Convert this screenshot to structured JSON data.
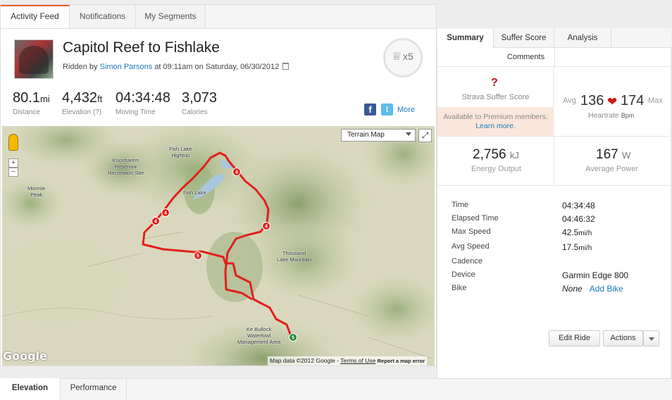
{
  "top_tabs": [
    "Activity Feed",
    "Notifications",
    "My Segments"
  ],
  "activity": {
    "title": "Capitol Reef to Fishlake",
    "ridden_by_prefix": "Ridden by",
    "athlete": "Simon Parsons",
    "datetime": "at 09:11am on Saturday, 06/30/2012",
    "trophy_count": "x5",
    "stats": [
      {
        "value": "80.1",
        "unit": "mi",
        "label": "Distance"
      },
      {
        "value": "4,432",
        "unit": "ft",
        "label": "Elevation (?)"
      },
      {
        "value": "04:34:48",
        "unit": "",
        "label": "Moving Time"
      },
      {
        "value": "3,073",
        "unit": "",
        "label": "Calories"
      }
    ],
    "share": {
      "facebook": "f",
      "twitter": "t",
      "more": "More"
    }
  },
  "map": {
    "type_select": "Terrain Map",
    "zoom_in": "+",
    "zoom_out": "−",
    "labels": [
      "Koosharem\nReservoir\nRecreation Site",
      "Fish Lake\nHightop",
      "Fish Lake",
      "Monroe\nPeak",
      "Thousand\nLake Mountain",
      "Ke Bullock\nWaterfowl\nManagement Area"
    ],
    "markers": [
      "4",
      "4",
      "4",
      "4",
      "5",
      "5"
    ],
    "logo": "Google",
    "attribution": "Map data ©2012 Google",
    "terms": "Terms of Use",
    "report": "Report a map error",
    "route_color": "#e0201b"
  },
  "right_tabs": [
    "Summary",
    "Suffer Score",
    "Analysis"
  ],
  "comments_tab": "Comments",
  "suffer": {
    "mark": "?",
    "label": "Strava Suffer Score",
    "premium_text": "Available to Premium members.",
    "learn_more": "Learn more."
  },
  "heartrate": {
    "avg_label": "Avg",
    "avg": "136",
    "max": "174",
    "max_label": "Max",
    "label": "Heartrate",
    "unit": "Bpm"
  },
  "energy": {
    "value": "2,756",
    "unit": "kJ",
    "label": "Energy Output"
  },
  "power": {
    "value": "167",
    "unit": "W",
    "label": "Average Power"
  },
  "details": [
    {
      "key": "Time",
      "value": "04:34:48",
      "unit": ""
    },
    {
      "key": "Elapsed Time",
      "value": "04:46:32",
      "unit": ""
    },
    {
      "key": "Max Speed",
      "value": "42.5",
      "unit": "mi/h"
    },
    {
      "key": "Avg Speed",
      "value": "17.5",
      "unit": "mi/h"
    },
    {
      "key": "Cadence",
      "value": "",
      "unit": ""
    },
    {
      "key": "Device",
      "value": "Garmin Edge 800",
      "unit": ""
    },
    {
      "key": "Bike",
      "value": "None",
      "unit": ""
    }
  ],
  "add_bike": "Add Bike",
  "buttons": {
    "edit": "Edit Ride",
    "actions": "Actions"
  },
  "bottom_tabs": [
    "Elevation",
    "Performance"
  ]
}
